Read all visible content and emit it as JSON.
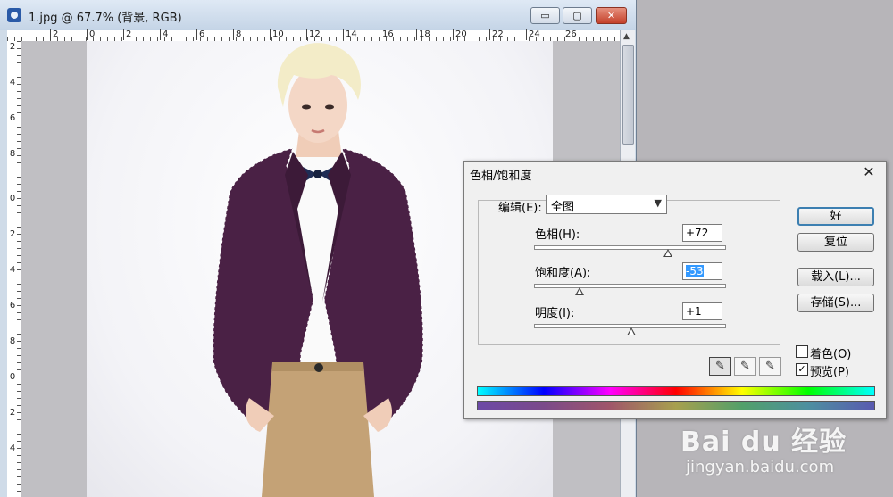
{
  "document_window": {
    "title": "1.jpg @ 67.7% (背景, RGB)",
    "buttons": {
      "minimize": "▭",
      "maximize": "▢",
      "close": "✕"
    },
    "ruler_h_ticks": [
      "2",
      "0",
      "2",
      "4",
      "6",
      "8",
      "10",
      "12",
      "14",
      "16",
      "18",
      "20",
      "22",
      "24",
      "26"
    ],
    "ruler_v_ticks": [
      "2",
      "4",
      "6",
      "8",
      "0",
      "2",
      "4",
      "6",
      "8",
      "0",
      "2",
      "4"
    ]
  },
  "dialog": {
    "title": "色相/饱和度",
    "close_label": "✕",
    "edit_label": "编辑(E):",
    "edit_value": "全图",
    "hue": {
      "label": "色相(H):",
      "value": "+72",
      "level": 72,
      "min": -180,
      "max": 180
    },
    "saturation": {
      "label": "饱和度(A):",
      "value": "-53",
      "level": -53,
      "min": -100,
      "max": 100
    },
    "lightness": {
      "label": "明度(I):",
      "value": "+1",
      "level": 1,
      "min": -100,
      "max": 100
    },
    "buttons": {
      "ok": "好",
      "reset": "复位",
      "load": "载入(L)...",
      "save": "存储(S)..."
    },
    "colorize": {
      "label": "着色(O)",
      "checked": false
    },
    "preview": {
      "label": "预览(P)",
      "checked": true
    },
    "eyedroppers": [
      "eyedropper",
      "eyedropper-plus",
      "eyedropper-minus"
    ]
  },
  "watermark": {
    "logo": "Bai du 经验",
    "url": "jingyan.baidu.com"
  },
  "colors": {
    "jacket": "#4a2145",
    "pants": "#c4a276",
    "hair": "#f3ecc8",
    "bowtie": "#1f2d55"
  }
}
